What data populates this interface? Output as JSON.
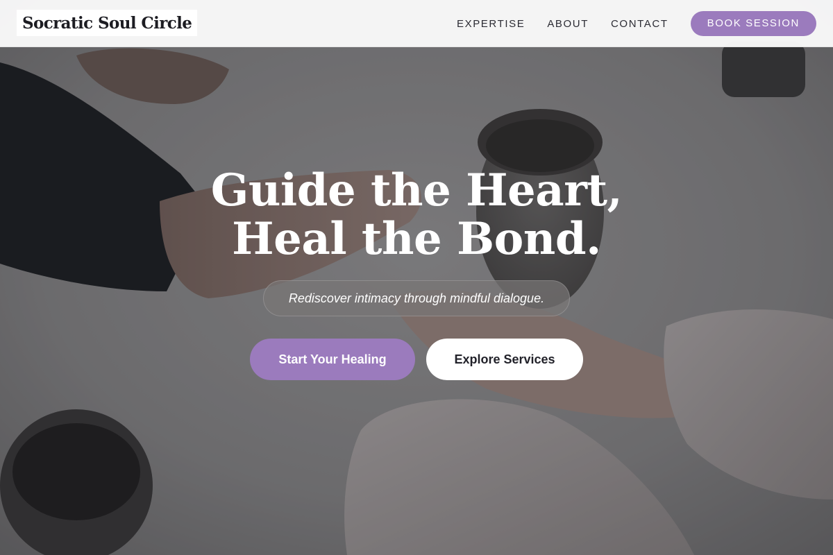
{
  "header": {
    "brand": "Socratic Soul Circle",
    "nav": [
      "EXPERTISE",
      "ABOUT",
      "CONTACT"
    ],
    "book_label": "BOOK SESSION"
  },
  "hero": {
    "title_line_1": "Guide the Heart,",
    "title_line_2": "Heal the Bond.",
    "tagline": "Rediscover intimacy through mindful dialogue.",
    "primary_cta": "Start Your Healing",
    "secondary_cta": "Explore Services"
  },
  "colors": {
    "accent": "#9b7bbd",
    "header_bg": "#fafafa",
    "text_dark": "#1c1c22"
  },
  "icons": []
}
